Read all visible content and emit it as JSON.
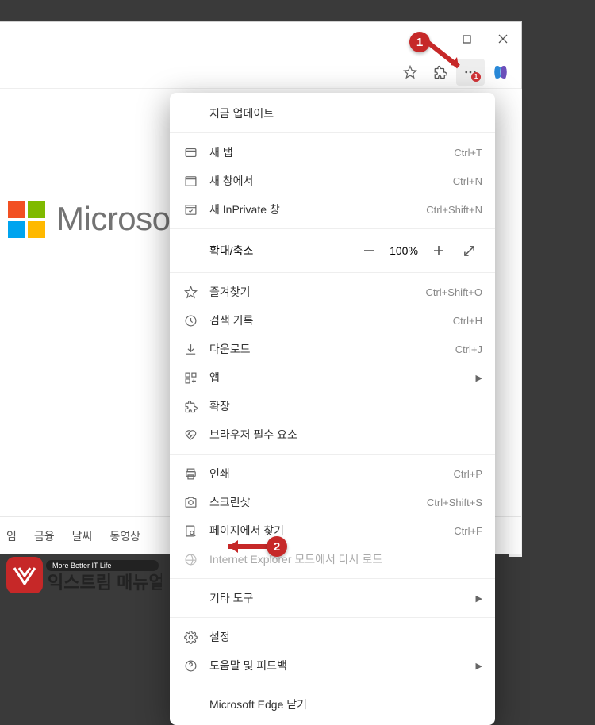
{
  "titlebar": {
    "maximize_tooltip": "최대화",
    "close_tooltip": "닫기"
  },
  "toolbar": {
    "favorite_tooltip": "즐겨찾기",
    "extensions_tooltip": "확장",
    "menu_tooltip": "설정 및 기타",
    "copilot_tooltip": "Copilot",
    "badge_count": "1"
  },
  "page": {
    "logo_text": "Microsof"
  },
  "bottom_tabs": [
    "임",
    "금융",
    "날씨",
    "동영상"
  ],
  "menu": {
    "update_now": "지금 업데이트",
    "new_tab": {
      "label": "새 탭",
      "shortcut": "Ctrl+T"
    },
    "new_window": {
      "label": "새 창에서",
      "shortcut": "Ctrl+N"
    },
    "new_inprivate": {
      "label": "새 InPrivate 창",
      "shortcut": "Ctrl+Shift+N"
    },
    "zoom": {
      "label": "확대/축소",
      "value": "100%"
    },
    "favorites": {
      "label": "즐겨찾기",
      "shortcut": "Ctrl+Shift+O"
    },
    "history": {
      "label": "검색 기록",
      "shortcut": "Ctrl+H"
    },
    "downloads": {
      "label": "다운로드",
      "shortcut": "Ctrl+J"
    },
    "apps": {
      "label": "앱"
    },
    "extensions": {
      "label": "확장"
    },
    "essentials": {
      "label": "브라우저 필수 요소"
    },
    "print": {
      "label": "인쇄",
      "shortcut": "Ctrl+P"
    },
    "screenshot": {
      "label": "스크린샷",
      "shortcut": "Ctrl+Shift+S"
    },
    "find": {
      "label": "페이지에서 찾기",
      "shortcut": "Ctrl+F"
    },
    "ie_mode": {
      "label": "Internet Explorer 모드에서 다시 로드"
    },
    "more_tools": {
      "label": "기타 도구"
    },
    "settings": {
      "label": "설정"
    },
    "help": {
      "label": "도움말 및 피드백"
    },
    "close_edge": {
      "label": "Microsoft Edge 닫기"
    }
  },
  "annotations": {
    "step1": "1",
    "step2": "2"
  },
  "site_badge": {
    "tagline": "More Better IT Life",
    "name": "익스트림 매뉴얼"
  }
}
